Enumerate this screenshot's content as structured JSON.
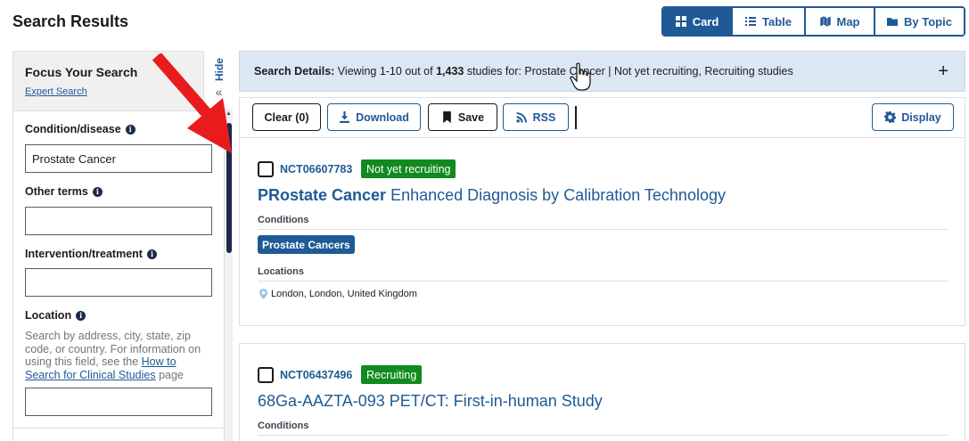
{
  "page_title": "Search Results",
  "view_toggle": [
    {
      "label": "Card",
      "icon": "grid-icon",
      "active": true
    },
    {
      "label": "Table",
      "icon": "list-icon",
      "active": false
    },
    {
      "label": "Map",
      "icon": "map-icon",
      "active": false
    },
    {
      "label": "By Topic",
      "icon": "folder-icon",
      "active": false
    }
  ],
  "sidebar": {
    "title": "Focus Your Search",
    "expert_link": "Expert Search",
    "hide_label": "Hide",
    "hide_chevron": "«",
    "condition": {
      "label": "Condition/disease",
      "value": "Prostate Cancer"
    },
    "other_terms": {
      "label": "Other terms",
      "value": ""
    },
    "intervention": {
      "label": "Intervention/treatment",
      "value": ""
    },
    "location": {
      "label": "Location",
      "help_prefix": "Search by address, city, state, zip code, or country. For information on using this field, see the ",
      "help_link": "How to Search for Clinical Studies",
      "help_suffix": " page",
      "value": ""
    },
    "info_glyph": "i"
  },
  "details": {
    "label": "Search Details:",
    "text_1": " Viewing 1-10 out of ",
    "count": "1,433",
    "text_2": " studies for: Prostate Cancer | Not yet recruiting, Recruiting studies",
    "expand_icon": "+"
  },
  "actions": {
    "clear": "Clear (0)",
    "download": "Download",
    "save": "Save",
    "rss": "RSS",
    "display": "Display"
  },
  "studies": [
    {
      "nct": "NCT06607783",
      "status": "Not yet recruiting",
      "title_bold": "PRostate Cancer",
      "title_rest": " Enhanced Diagnosis by Calibration Technology",
      "conditions_label": "Conditions",
      "conditions": [
        "Prostate Cancers"
      ],
      "locations_label": "Locations",
      "location": "London, London, United Kingdom"
    },
    {
      "nct": "NCT06437496",
      "status": "Recruiting",
      "title_bold": "",
      "title_rest": "68Ga-AAZTA-093 PET/CT: First-in-human Study",
      "conditions_label": "Conditions"
    }
  ],
  "colors": {
    "primary": "#1f5a96",
    "status_green": "#118a1f",
    "details_bg": "#dbe7f3",
    "annotation_arrow": "#e81c1c"
  }
}
